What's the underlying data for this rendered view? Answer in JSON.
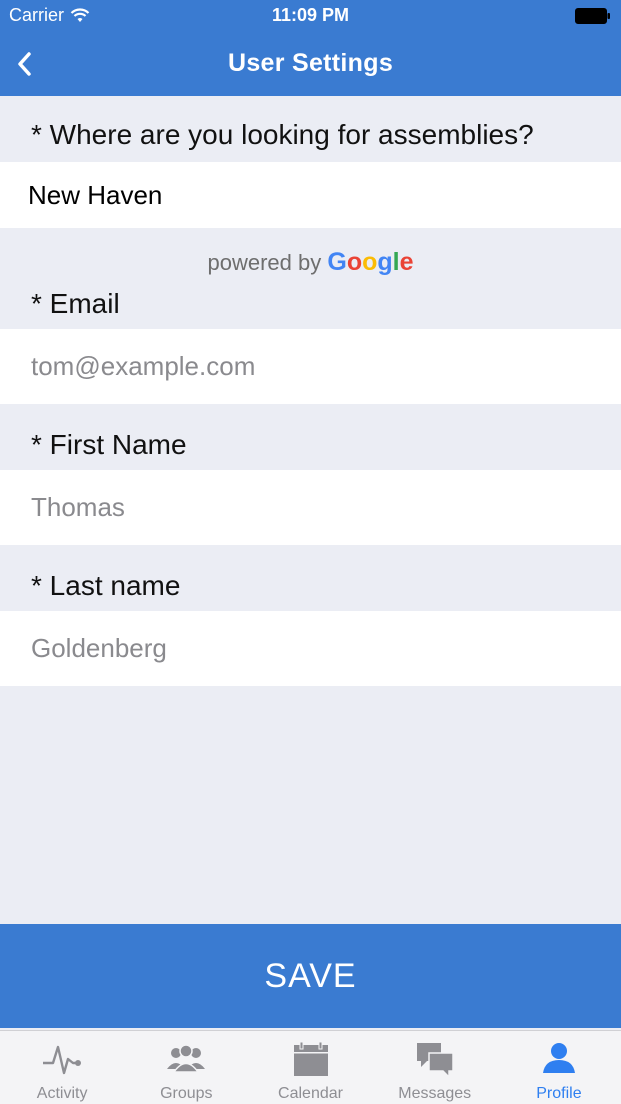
{
  "status_bar": {
    "carrier": "Carrier",
    "time": "11:09 PM"
  },
  "nav": {
    "title": "User Settings",
    "back_icon": "chevron-left-icon"
  },
  "form": {
    "location": {
      "label": "* Where are you looking for assemblies?",
      "value": "New Haven"
    },
    "powered_by": {
      "prefix": "powered by",
      "brand_letters": [
        "G",
        "o",
        "o",
        "g",
        "l",
        "e"
      ],
      "brand_colors": [
        "#4285F4",
        "#EA4335",
        "#FBBC05",
        "#4285F4",
        "#34A853",
        "#EA4335"
      ]
    },
    "email": {
      "label": "* Email",
      "placeholder": "tom@example.com"
    },
    "first_name": {
      "label": "* First Name",
      "placeholder": "Thomas"
    },
    "last_name": {
      "label": "* Last name",
      "placeholder": "Goldenberg"
    }
  },
  "save_button": {
    "label": "SAVE"
  },
  "tab_bar": {
    "items": [
      {
        "label": "Activity",
        "icon": "activity-pulse-icon",
        "active": false
      },
      {
        "label": "Groups",
        "icon": "groups-icon",
        "active": false
      },
      {
        "label": "Calendar",
        "icon": "calendar-icon",
        "active": false
      },
      {
        "label": "Messages",
        "icon": "messages-icon",
        "active": false
      },
      {
        "label": "Profile",
        "icon": "profile-icon",
        "active": true
      }
    ]
  },
  "colors": {
    "primary": "#3a7bd1",
    "background": "#ebedf4",
    "tab_active": "#2f7ff0",
    "tab_inactive": "#8e8e93"
  }
}
